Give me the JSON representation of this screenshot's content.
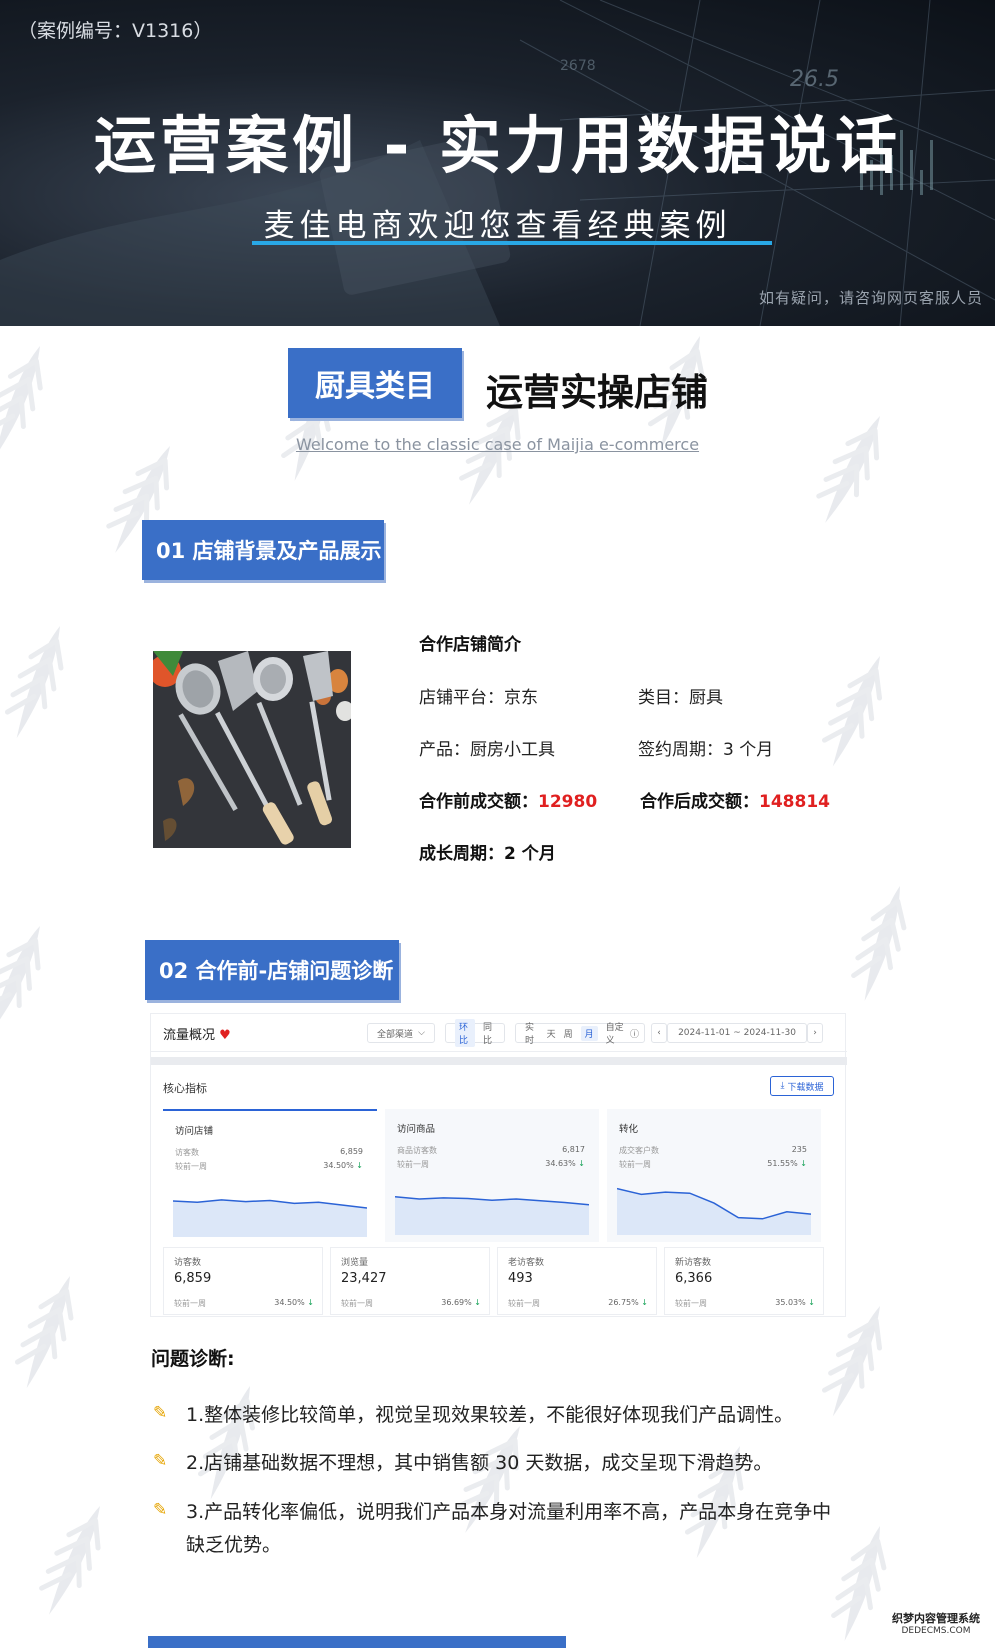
{
  "hero": {
    "case_no": "（案例编号：V1316）",
    "title": "运营案例 - 实力用数据说话",
    "subtitle": "麦佳电商欢迎您查看经典案例",
    "hint": "如有疑问，请咨询网页客服人员"
  },
  "category": {
    "badge": "厨具类目",
    "title": "运营实操店铺",
    "welcome": "Welcome to the classic case of Maijia e-commerce"
  },
  "section1": {
    "heading": "01 店铺背景及产品展示",
    "info_heading": "合作店铺简介",
    "platform": "店铺平台：京东",
    "category": "类目：厨具",
    "product": "产品：厨房小工具",
    "period": "签约周期：3 个月",
    "before_label": "合作前成交额：",
    "before_value": "12980",
    "after_label": "合作后成交额：",
    "after_value": "148814",
    "growth": "成长周期：2 个月"
  },
  "section2": {
    "heading": "02 合作前-店铺问题诊断"
  },
  "dashboard": {
    "title": "流量概况",
    "channel": "全部渠道",
    "channel_arrow": "⌵",
    "compare_on": "环比",
    "compare_off": "同比",
    "periods": [
      "实时",
      "天",
      "周"
    ],
    "period_on": "月",
    "custom": "自定义",
    "custom_icon": "ⓘ",
    "date_range": "2024-11-01 ~ 2024-11-30",
    "prev": "‹",
    "next": "›",
    "core_label": "核心指标",
    "download": "下载数据",
    "download_icon": "⤓",
    "panels": [
      {
        "title": "访问店铺",
        "k1": "访客数",
        "v1": "6,859",
        "k2": "较前一周",
        "v2": "34.50%",
        "arrow": "↓",
        "trend": [
          0.62,
          0.6,
          0.64,
          0.61,
          0.63,
          0.58,
          0.6,
          0.55,
          0.5
        ]
      },
      {
        "title": "访问商品",
        "k1": "商品访客数",
        "v1": "6,817",
        "k2": "较前一周",
        "v2": "34.63%",
        "arrow": "↓",
        "trend": [
          0.66,
          0.62,
          0.64,
          0.63,
          0.6,
          0.62,
          0.59,
          0.56,
          0.52
        ]
      },
      {
        "title": "转化",
        "k1": "成交客户数",
        "v1": "235",
        "k2": "较前一周",
        "v2": "51.55%",
        "arrow": "↓",
        "trend": [
          0.8,
          0.7,
          0.74,
          0.72,
          0.55,
          0.3,
          0.28,
          0.4,
          0.36
        ]
      }
    ],
    "stats": [
      {
        "label": "访客数",
        "value": "6,859",
        "compare": "较前一周",
        "pct": "34.50%",
        "arrow": "↓"
      },
      {
        "label": "浏览量",
        "value": "23,427",
        "compare": "较前一周",
        "pct": "36.69%",
        "arrow": "↓"
      },
      {
        "label": "老访客数",
        "value": "493",
        "compare": "较前一周",
        "pct": "26.75%",
        "arrow": "↓"
      },
      {
        "label": "新访客数",
        "value": "6,366",
        "compare": "较前一周",
        "pct": "35.03%",
        "arrow": "↓"
      }
    ]
  },
  "diagnosis": {
    "title": "问题诊断:",
    "items": [
      "1.整体装修比较简单，视觉呈现效果较差，不能很好体现我们产品调性。",
      "2.店铺基础数据不理想，其中销售额 30 天数据，成交呈现下滑趋势。",
      "3.产品转化率偏低，说明我们产品本身对流量利用率不高，产品本身在竞争中缺乏优势。"
    ]
  },
  "watermark": {
    "line1": "织梦内容管理系统",
    "line2": "DEDECMS.COM"
  },
  "colors": {
    "accent": "#3a6fc7",
    "highlight": "#e02020",
    "hero_line": "#29a8e6"
  }
}
